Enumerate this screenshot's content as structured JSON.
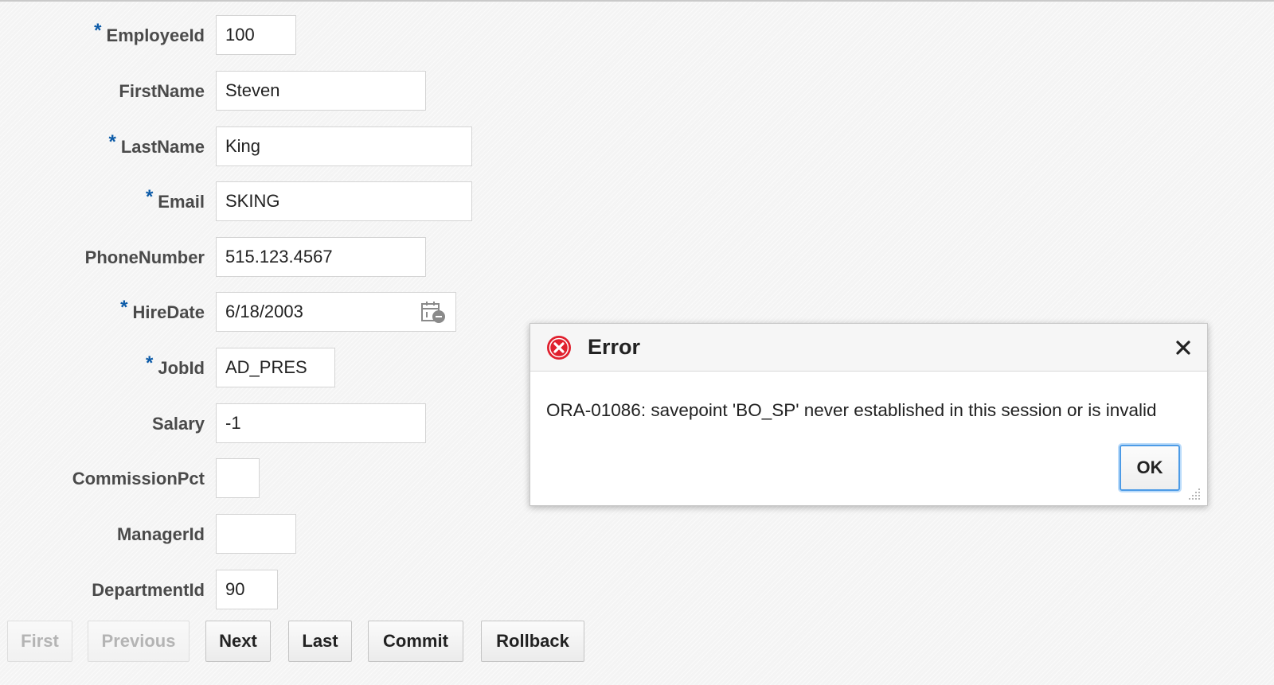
{
  "form": {
    "fields": [
      {
        "label": "EmployeeId",
        "required": true,
        "value": "100"
      },
      {
        "label": "FirstName",
        "required": false,
        "value": "Steven"
      },
      {
        "label": "LastName",
        "required": true,
        "value": "King"
      },
      {
        "label": "Email",
        "required": true,
        "value": "SKING"
      },
      {
        "label": "PhoneNumber",
        "required": false,
        "value": "515.123.4567"
      },
      {
        "label": "HireDate",
        "required": true,
        "value": "6/18/2003"
      },
      {
        "label": "JobId",
        "required": true,
        "value": "AD_PRES"
      },
      {
        "label": "Salary",
        "required": false,
        "value": "-1"
      },
      {
        "label": "CommissionPct",
        "required": false,
        "value": ""
      },
      {
        "label": "ManagerId",
        "required": false,
        "value": ""
      },
      {
        "label": "DepartmentId",
        "required": false,
        "value": "90"
      }
    ],
    "required_marker": "*"
  },
  "buttons": {
    "first": {
      "label": "First",
      "enabled": false
    },
    "previous": {
      "label": "Previous",
      "enabled": false
    },
    "next": {
      "label": "Next",
      "enabled": true
    },
    "last": {
      "label": "Last",
      "enabled": true
    },
    "commit": {
      "label": "Commit",
      "enabled": true
    },
    "rollback": {
      "label": "Rollback",
      "enabled": true
    }
  },
  "dialog": {
    "title": "Error",
    "message": "ORA-01086: savepoint 'BO_SP' never established in this session or is invalid",
    "ok_label": "OK"
  },
  "icons": {
    "error": "error-circle-x-icon",
    "close": "close-x-icon",
    "calendar": "calendar-icon",
    "resize": "resize-grip-icon"
  },
  "colors": {
    "required_marker": "#0c5ba8",
    "error_icon": "#e0202e",
    "ok_focus_ring": "#4d9be6"
  }
}
